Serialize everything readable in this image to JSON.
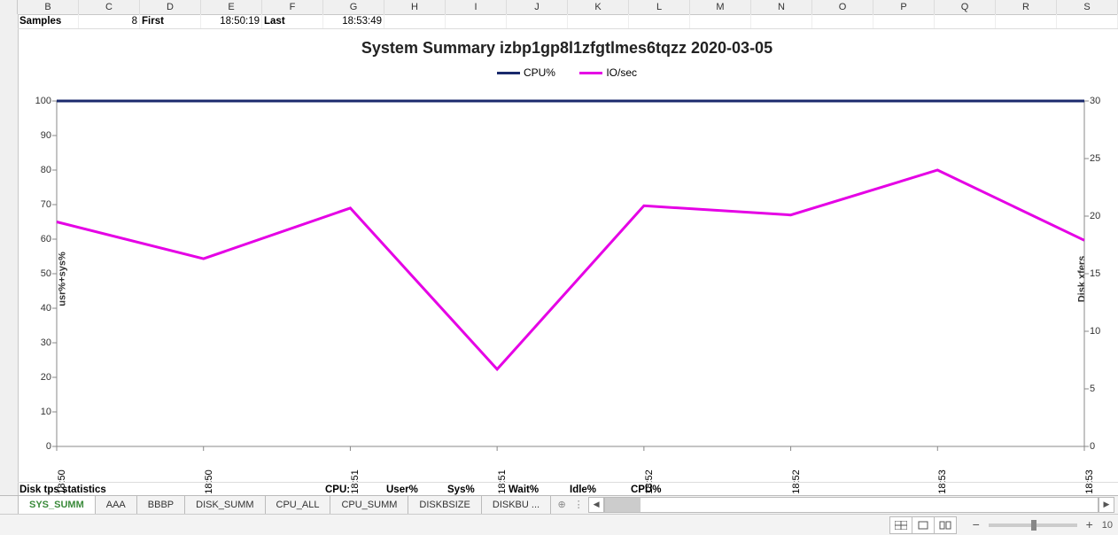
{
  "columns": [
    "B",
    "C",
    "D",
    "E",
    "F",
    "G",
    "H",
    "I",
    "J",
    "K",
    "L",
    "M",
    "N",
    "O",
    "P",
    "Q",
    "R",
    "S"
  ],
  "row1": {
    "B": "Samples",
    "C": "8",
    "D": "First",
    "E": "18:50:19",
    "F": "Last",
    "G": "18:53:49"
  },
  "bottomRow": {
    "B": "Disk tps statistics",
    "G": "CPU:",
    "H": "User%",
    "I": "Sys%",
    "J": "Wait%",
    "K": "Idle%",
    "L": "CPU%"
  },
  "chart_data": {
    "type": "line",
    "title": "System Summary izbp1gp8l1zfgtlmes6tqzz  2020-03-05",
    "legend_position": "top-center",
    "xlabel": "",
    "x_categories": [
      "18:50",
      "18:50",
      "18:51",
      "18:51",
      "18:52",
      "18:52",
      "18:53",
      "18:53"
    ],
    "y_left": {
      "label": "usr%+sys%",
      "min": 0,
      "max": 100,
      "ticks": [
        0,
        10,
        20,
        30,
        40,
        50,
        60,
        70,
        80,
        90,
        100
      ]
    },
    "y_right": {
      "label": "Disk xfers",
      "min": 0,
      "max": 30,
      "ticks": [
        0,
        5,
        10,
        15,
        20,
        25,
        30
      ]
    },
    "series": [
      {
        "name": "CPU%",
        "color": "#1a2a6c",
        "axis": "left",
        "values": [
          100,
          100,
          100,
          100,
          100,
          100,
          100,
          100
        ]
      },
      {
        "name": "IO/sec",
        "color": "#e500e5",
        "axis": "right",
        "values": [
          19.5,
          16.3,
          20.7,
          6.7,
          20.9,
          20.1,
          24.0,
          17.9
        ]
      }
    ],
    "grid": false
  },
  "sheet_tabs": {
    "active": "SYS_SUMM",
    "tabs": [
      "SYS_SUMM",
      "AAA",
      "BBBP",
      "DISK_SUMM",
      "CPU_ALL",
      "CPU_SUMM",
      "DISKBSIZE",
      "DISKBU ..."
    ]
  },
  "statusbar": {
    "zoom_label": "10"
  }
}
